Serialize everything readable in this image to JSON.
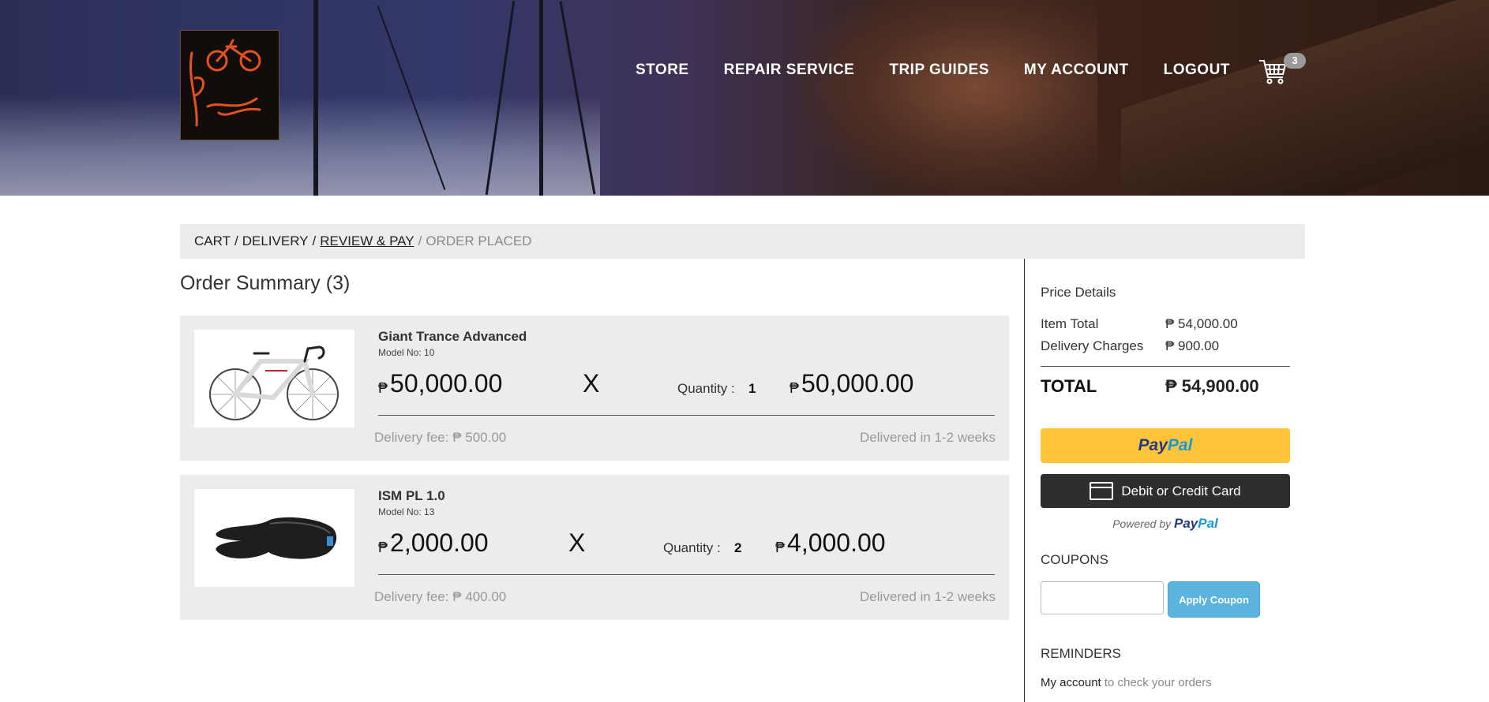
{
  "header": {
    "nav": [
      {
        "label": "STORE"
      },
      {
        "label": "REPAIR SERVICE"
      },
      {
        "label": "TRIP GUIDES"
      },
      {
        "label": "MY ACCOUNT"
      },
      {
        "label": "LOGOUT"
      }
    ],
    "cart_count": "3",
    "logo_icon": "bicycle-logo-icon",
    "cart_icon": "shopping-cart-icon"
  },
  "breadcrumb": {
    "steps": [
      "CART",
      "DELIVERY",
      "REVIEW & PAY",
      "ORDER PLACED"
    ],
    "separator": "/"
  },
  "order": {
    "title": "Order Summary (3)",
    "currency": "₱",
    "times_sign": "X",
    "quantity_label": "Quantity :",
    "items": [
      {
        "name": "Giant Trance Advanced",
        "model": "Model No: 10",
        "price": "50,000.00",
        "quantity": "1",
        "subtotal": "50,000.00",
        "delivery_fee": "Delivery fee: ₱ 500.00",
        "eta": "Delivered in 1-2 weeks",
        "image_icon": "road-bike-image"
      },
      {
        "name": "ISM PL 1.0",
        "model": "Model No: 13",
        "price": "2,000.00",
        "quantity": "2",
        "subtotal": "4,000.00",
        "delivery_fee": "Delivery fee: ₱ 400.00",
        "eta": "Delivered in 1-2 weeks",
        "image_icon": "bike-saddle-image"
      }
    ]
  },
  "price_details": {
    "title": "Price Details",
    "item_total_label": "Item Total",
    "item_total": "₱ 54,000.00",
    "delivery_label": "Delivery Charges",
    "delivery": "₱ 900.00",
    "total_label": "TOTAL",
    "total": "₱ 54,900.00"
  },
  "payment": {
    "paypal_a": "Pay",
    "paypal_b": "Pal",
    "card_label": "Debit or Credit Card",
    "powered_by": "Powered by",
    "colors": {
      "paypal_yellow": "#ffc439",
      "card_dark": "#2c2e2f",
      "paypal_navy": "#253b80",
      "paypal_blue": "#179bd7"
    }
  },
  "coupons": {
    "title": "COUPONS",
    "input_value": "",
    "apply_label": "Apply Coupon"
  },
  "reminders": {
    "title": "REMINDERS",
    "link": "My account",
    "text": " to check your orders"
  }
}
